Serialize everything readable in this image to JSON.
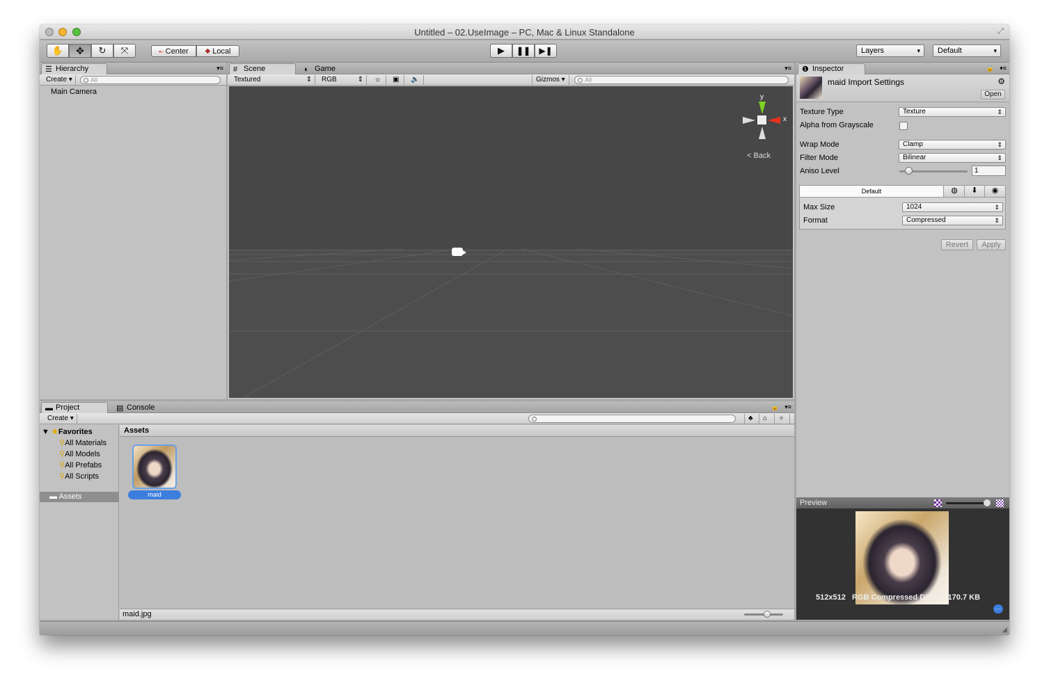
{
  "window": {
    "title": "Untitled – 02.UseImage – PC, Mac & Linux Standalone"
  },
  "toolbar": {
    "pivot": "Center",
    "space": "Local",
    "layers": "Layers",
    "layout": "Default"
  },
  "hierarchy": {
    "tab": "Hierarchy",
    "create": "Create",
    "search_placeholder": "All",
    "items": [
      "Main Camera"
    ]
  },
  "scene": {
    "tab_scene": "Scene",
    "tab_game": "Game",
    "render_mode": "Textured",
    "channel": "RGB",
    "gizmos": "Gizmos",
    "search_placeholder": "All",
    "axis_y": "y",
    "axis_x": "x",
    "view_label": "Back"
  },
  "inspector": {
    "tab": "Inspector",
    "asset_title": "maid Import Settings",
    "open_label": "Open",
    "texture_type_label": "Texture Type",
    "texture_type": "Texture",
    "alpha_label": "Alpha from Grayscale",
    "wrap_label": "Wrap Mode",
    "wrap": "Clamp",
    "filter_label": "Filter Mode",
    "filter": "Bilinear",
    "aniso_label": "Aniso Level",
    "aniso": "1",
    "platform_tab": "Default",
    "maxsize_label": "Max Size",
    "maxsize": "1024",
    "format_label": "Format",
    "format": "Compressed",
    "revert": "Revert",
    "apply": "Apply"
  },
  "preview": {
    "title": "Preview",
    "resolution": "512x512",
    "format": "RGB Compressed DXT1",
    "size": "170.7 KB"
  },
  "project": {
    "tab_project": "Project",
    "tab_console": "Console",
    "create": "Create",
    "favorites": "Favorites",
    "favorite_items": [
      "All Materials",
      "All Models",
      "All Prefabs",
      "All Scripts"
    ],
    "assets_folder": "Assets",
    "assets_header": "Assets",
    "asset_name": "maid",
    "status_file": "maid.jpg"
  },
  "colors": {
    "scene_bg": "#4a4a4a",
    "selection": "#3c7ede",
    "axis_y": "#7ed321",
    "axis_x": "#e8321e"
  },
  "icons": [
    "hand-icon",
    "move-icon",
    "rotate-icon",
    "scale-icon",
    "play-icon",
    "pause-icon",
    "step-icon",
    "lock-icon",
    "gear-icon",
    "camera-icon",
    "folder-icon",
    "star-icon"
  ]
}
